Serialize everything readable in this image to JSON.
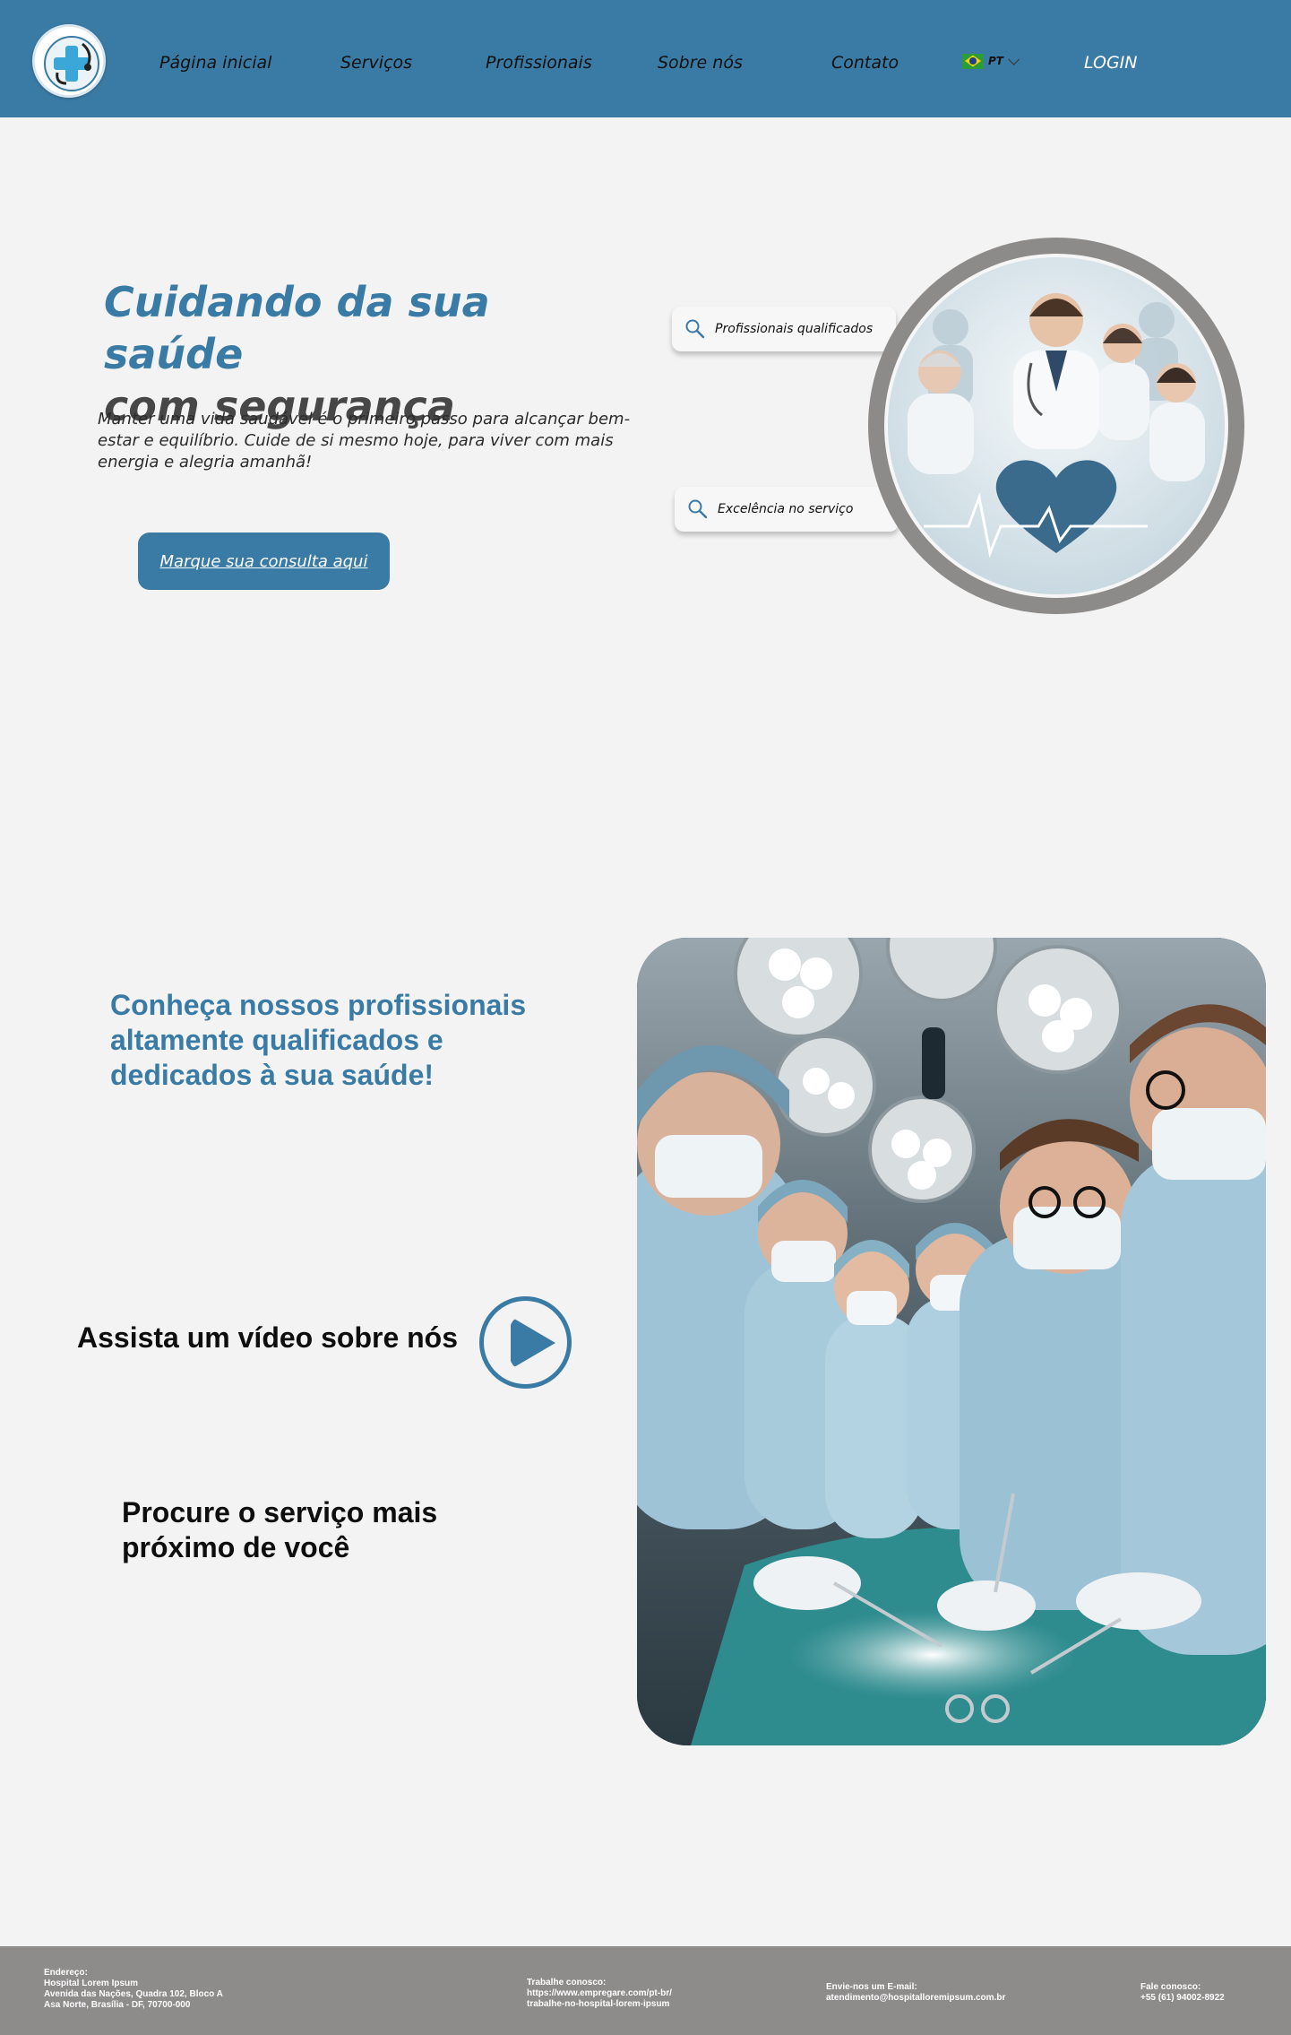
{
  "nav": {
    "items": [
      "Página inicial",
      "Serviços",
      "Profissionais",
      "Sobre nós",
      "Contato"
    ],
    "language": "PT",
    "login": "LOGIN"
  },
  "hero": {
    "title_line1": "Cuidando da sua saúde",
    "title_line2": "com segurança",
    "text": "Manter uma vida saudável é o primeiro passo para alcançar bem-estar e equilíbrio. Cuide de si mesmo hoje, para viver com mais energia e alegria amanhã!",
    "cta": "Marque sua consulta aqui",
    "pill1": "Profissionais qualificados",
    "pill2": "Excelência no serviço"
  },
  "section2": {
    "title": "Conheça nossos profissionais altamente qualificados e dedicados à sua saúde!",
    "video_label": "Assista um vídeo sobre nós",
    "service_label": "Procure o serviço mais próximo de você"
  },
  "footer": {
    "address": {
      "label": "Endereço:",
      "line1": "Hospital Lorem Ipsum",
      "line2": "Avenida das Nações, Quadra 102, Bloco A",
      "line3": "Asa Norte, Brasília - DF, 70700-000"
    },
    "jobs": {
      "label": "Trabalhe conosco:",
      "line1": "https://www.empregare.com/pt-br/",
      "line2": "trabalhe-no-hospital-lorem-ipsum"
    },
    "email": {
      "label": "Envie-nos um E-mail:",
      "line1": "atendimento@hospitalloremipsum.com.br"
    },
    "phone": {
      "label": "Fale conosco:",
      "line1": "+55 (61) 94002-8922"
    }
  },
  "colors": {
    "primary": "#3a7ba5",
    "background": "#f3f3f3",
    "footer": "#8e8b8b",
    "ring": "#8d8a8a"
  },
  "icons": [
    "hospital-logo-icon",
    "brazil-flag-icon",
    "chevron-down-icon",
    "search-icon",
    "play-icon"
  ]
}
